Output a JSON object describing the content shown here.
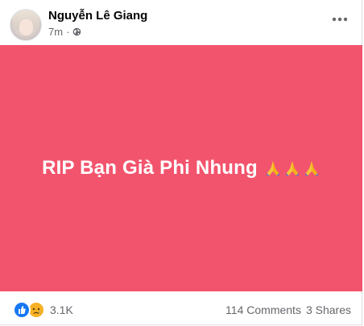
{
  "post": {
    "author_name": "Nguyễn Lê Giang",
    "time_ago": "7m",
    "time_separator": "·",
    "privacy_icon": "globe-icon",
    "more_icon": "more-horizontal-icon"
  },
  "content": {
    "text": "RIP Bạn Già Phi Nhung",
    "emoji_icon": "folded-hands-icon",
    "emoji_count": 3,
    "background_color": "#f3546d",
    "text_color": "#ffffff"
  },
  "footer": {
    "reaction_icons": [
      "like-icon",
      "sad-icon"
    ],
    "reaction_count": "3.1K",
    "comments": "114 Comments",
    "shares": "3 Shares"
  },
  "colors": {
    "secondary_text": "#65676b",
    "like_blue": "#1877f2",
    "sad_yellow": "#f7b125"
  }
}
